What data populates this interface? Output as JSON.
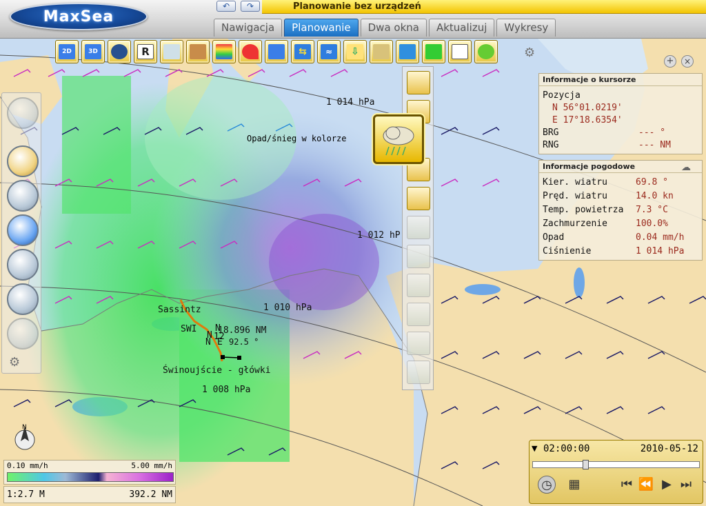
{
  "app": {
    "logo_text": "MaxSea",
    "title": "Planowanie bez urządzeń",
    "undo_label": "↶",
    "redo_label": "↷"
  },
  "tabs": [
    {
      "label": "Nawigacja",
      "active": false
    },
    {
      "label": "Planowanie",
      "active": true
    },
    {
      "label": "Dwa okna",
      "active": false
    },
    {
      "label": "Aktualizuj",
      "active": false
    },
    {
      "label": "Wykresy",
      "active": false
    }
  ],
  "toolbar": {
    "items": [
      {
        "name": "view-2d-icon",
        "label": "2D"
      },
      {
        "name": "view-3d-icon",
        "label": "3D"
      },
      {
        "name": "globe-icon",
        "label": ""
      },
      {
        "name": "raster-chart-icon",
        "label": "R"
      },
      {
        "name": "vector-chart-icon",
        "label": ""
      },
      {
        "name": "photo-chart-icon",
        "label": ""
      },
      {
        "name": "bathymetry-icon",
        "label": ""
      },
      {
        "name": "route-pen-icon",
        "label": ""
      },
      {
        "name": "instruments-icon",
        "label": ""
      },
      {
        "name": "currents-icon",
        "label": ""
      },
      {
        "name": "tides-icon",
        "label": ""
      },
      {
        "name": "download-icon",
        "label": ""
      },
      {
        "name": "weather-icon",
        "label": ""
      },
      {
        "name": "sea-state-icon",
        "label": ""
      },
      {
        "name": "flags-icon",
        "label": ""
      },
      {
        "name": "table-icon",
        "label": ""
      },
      {
        "name": "settings-tools-icon",
        "label": ""
      }
    ]
  },
  "weather_menu": {
    "tooltip": "Opad/śnieg w kolorze"
  },
  "map_labels": {
    "isobar_1": "1 014 hPa",
    "isobar_2": "1 012 hP",
    "isobar_3": "1 010 hPa",
    "isobar_4": "1 008 hPa",
    "place_1": "Sassintz",
    "place_2": "Świnoujście - główki",
    "route_swi": "SWI",
    "route_n1": "N",
    "route_n2": "N",
    "route_ne": "N",
    "route_e": "E",
    "route_dist": "18.896 NM",
    "route_12": "12",
    "route_brg": "92.5 °"
  },
  "cursor_info": {
    "title": "Informacje o kursorze",
    "position_label": "Pozycja",
    "lat": "N 56°01.0219'",
    "lon": "E 17°18.6354'",
    "brg_label": "BRG",
    "brg_value": "--- °",
    "rng_label": "RNG",
    "rng_value": "--- NM"
  },
  "weather_info": {
    "title": "Informacje pogodowe",
    "rows": [
      {
        "label": "Kier. wiatru",
        "value": "69.8 °"
      },
      {
        "label": "Pręd. wiatru",
        "value": "14.0 kn"
      },
      {
        "label": "Temp. powietrza",
        "value": "7.3 °C"
      },
      {
        "label": "Zachmurzenie",
        "value": "100.0%"
      },
      {
        "label": "Opad",
        "value": "0.04 mm/h"
      },
      {
        "label": "Ciśnienie",
        "value": "1 014 hPa"
      }
    ]
  },
  "legend": {
    "min": "0.10 mm/h",
    "max": "5.00 mm/h"
  },
  "scale": {
    "ratio": "1:2.7 M",
    "width": "392.2 NM"
  },
  "time_panel": {
    "time": "02:00:00",
    "date": "2010-05-12",
    "slider_fraction": 0.31
  }
}
